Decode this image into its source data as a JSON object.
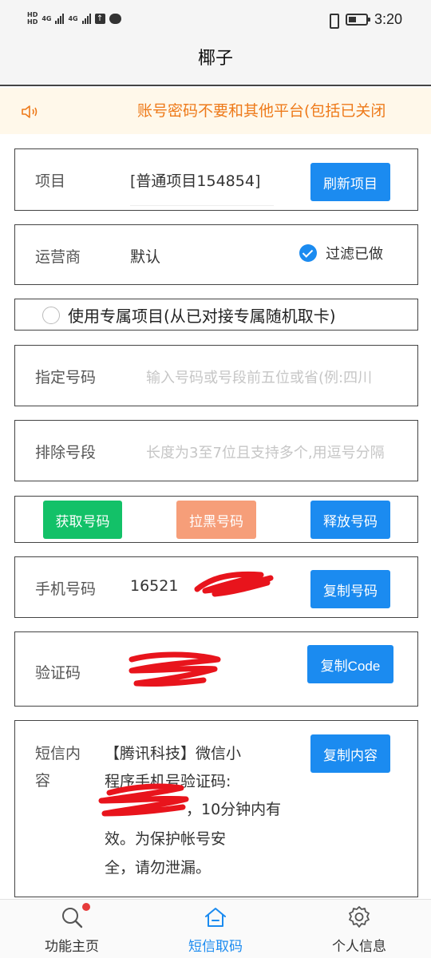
{
  "status_bar": {
    "network_left": "4G",
    "network_right": "4G",
    "time": "3:20"
  },
  "title": "椰子",
  "notice": {
    "text": "账号密码不要和其他平台(包括已关闭",
    "icon": "speaker-icon"
  },
  "project": {
    "label": "项目",
    "value": "[普通项目154854]",
    "button": "刷新项目"
  },
  "carrier": {
    "label": "运营商",
    "value": "默认",
    "checkbox_label": "过滤已做",
    "checked": true
  },
  "exclusive": {
    "label": "使用专属项目(从已对接专属随机取卡)",
    "checked": false
  },
  "specify_number": {
    "label": "指定号码",
    "placeholder": "输入号码或号段前五位或省(例:四川"
  },
  "exclude_segment": {
    "label": "排除号段",
    "placeholder": "长度为3至7位且支持多个,用逗号分隔"
  },
  "actions": {
    "get": "获取号码",
    "block": "拉黑号码",
    "release": "释放号码"
  },
  "phone": {
    "label": "手机号码",
    "value": "16521",
    "button": "复制号码"
  },
  "code": {
    "label": "验证码",
    "button": "复制Code"
  },
  "sms": {
    "label": "短信内容",
    "label_line1": "短信内",
    "label_line2": "容",
    "line1": "【腾讯科技】微信小",
    "line2": "程序手机号验证码:",
    "line3": "，10分钟内有",
    "line4": "效。为保护帐号安",
    "line5": "全，请勿泄漏。",
    "button": "复制内容"
  },
  "tabs": [
    {
      "label": "功能主页",
      "icon": "search-icon",
      "badge": true
    },
    {
      "label": "短信取码",
      "icon": "home-icon",
      "active": true
    },
    {
      "label": "个人信息",
      "icon": "gear-icon"
    }
  ],
  "colors": {
    "accent": "#1b8bf0",
    "notice_text": "#ee7a1a",
    "notice_bg": "#fff8ea",
    "green": "#13c168",
    "salmon": "#f69e79",
    "redaction": "#e8141c"
  }
}
